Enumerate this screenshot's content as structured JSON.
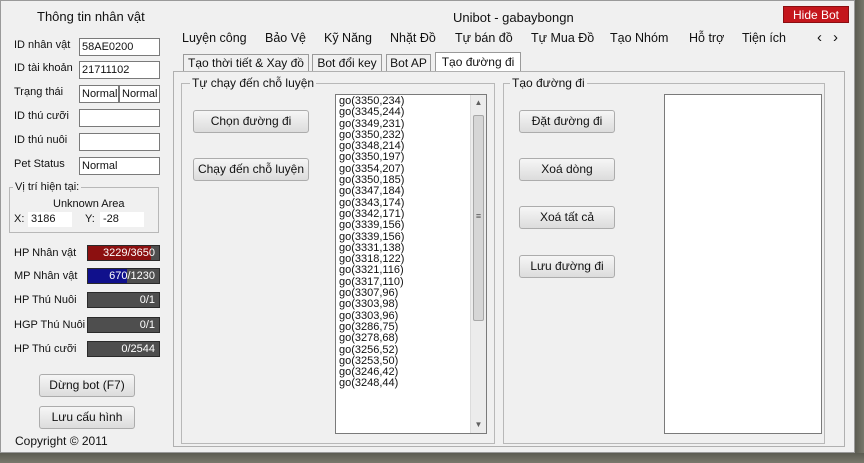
{
  "window_title": "Unibot - gabaybongn",
  "hide_button": "Hide Bot",
  "sidebar": {
    "title": "Thông tin nhân vật",
    "fields": [
      {
        "label": "ID nhân vật",
        "value": "58AE0200"
      },
      {
        "label": "ID tài khoản",
        "value": "21711102"
      },
      {
        "label": "Trạng thái",
        "value": "Normal",
        "value2": "Normal"
      },
      {
        "label": "ID thú cưỡi",
        "value": ""
      },
      {
        "label": "ID thú nuôi",
        "value": ""
      },
      {
        "label": "Pet Status",
        "value": "Normal"
      }
    ],
    "position": {
      "title": "Vị trí hiện tại:",
      "area": "Unknown Area",
      "x_label": "X:",
      "x_value": "3186",
      "y_label": "Y:",
      "y_value": "-28"
    },
    "bars": [
      {
        "label": "HP Nhân vật",
        "text": "3229/3650",
        "fraction": 0.885,
        "color": "#8c1010"
      },
      {
        "label": "MP Nhân vật",
        "text": "670/1230",
        "fraction": 0.545,
        "color": "#10108c"
      },
      {
        "label": "HP Thú Nuôi",
        "text": "0/1",
        "fraction": 0.0,
        "color": "#8c1010"
      },
      {
        "label": "HGP Thú Nuôi",
        "text": "0/1",
        "fraction": 0.0,
        "color": "#8c1010"
      },
      {
        "label": "HP Thú cưỡi",
        "text": "0/2544",
        "fraction": 0.0,
        "color": "#8c1010"
      }
    ],
    "stop_button": "Dừng bot (F7)",
    "save_button": "Lưu cấu hình",
    "copyright": "Copyright © 2011"
  },
  "menu": [
    "Luyện công",
    "Bảo Vệ",
    "Kỹ Năng",
    "Nhặt Đồ",
    "Tự bán đồ",
    "Tự Mua Đồ",
    "Tạo Nhóm",
    "Hỗ trợ",
    "Tiện ích"
  ],
  "menu_arrows": {
    "left": "‹",
    "right": "›"
  },
  "tabs": [
    "Tạo thời tiết & Xay đồ",
    "Bot đổi key",
    "Bot AP",
    "Tạo đường đi"
  ],
  "left_group": {
    "title": "Tự chạy đến chỗ luyện",
    "buttons": [
      "Chọn đường đi",
      "Chạy đến chỗ luyện"
    ]
  },
  "list_items": [
    "go(3350,234)",
    "go(3345,244)",
    "go(3349,231)",
    "go(3350,232)",
    "go(3348,214)",
    "go(3350,197)",
    "go(3354,207)",
    "go(3350,185)",
    "go(3347,184)",
    "go(3343,174)",
    "go(3342,171)",
    "go(3339,156)",
    "go(3339,156)",
    "go(3331,138)",
    "go(3318,122)",
    "go(3321,116)",
    "go(3317,110)",
    "go(3307,96)",
    "go(3303,98)",
    "go(3303,96)",
    "go(3286,75)",
    "go(3278,68)",
    "go(3256,52)",
    "go(3253,50)",
    "go(3246,42)",
    "go(3248,44)"
  ],
  "right_group": {
    "title": "Tạo đường đi",
    "buttons": [
      "Đặt đường đi",
      "Xoá dòng",
      "Xoá tất cả",
      "Lưu đường đi"
    ]
  },
  "icons": {
    "scroll_up": "▲",
    "scroll_down": "▼",
    "scroll_grip": "≡"
  }
}
